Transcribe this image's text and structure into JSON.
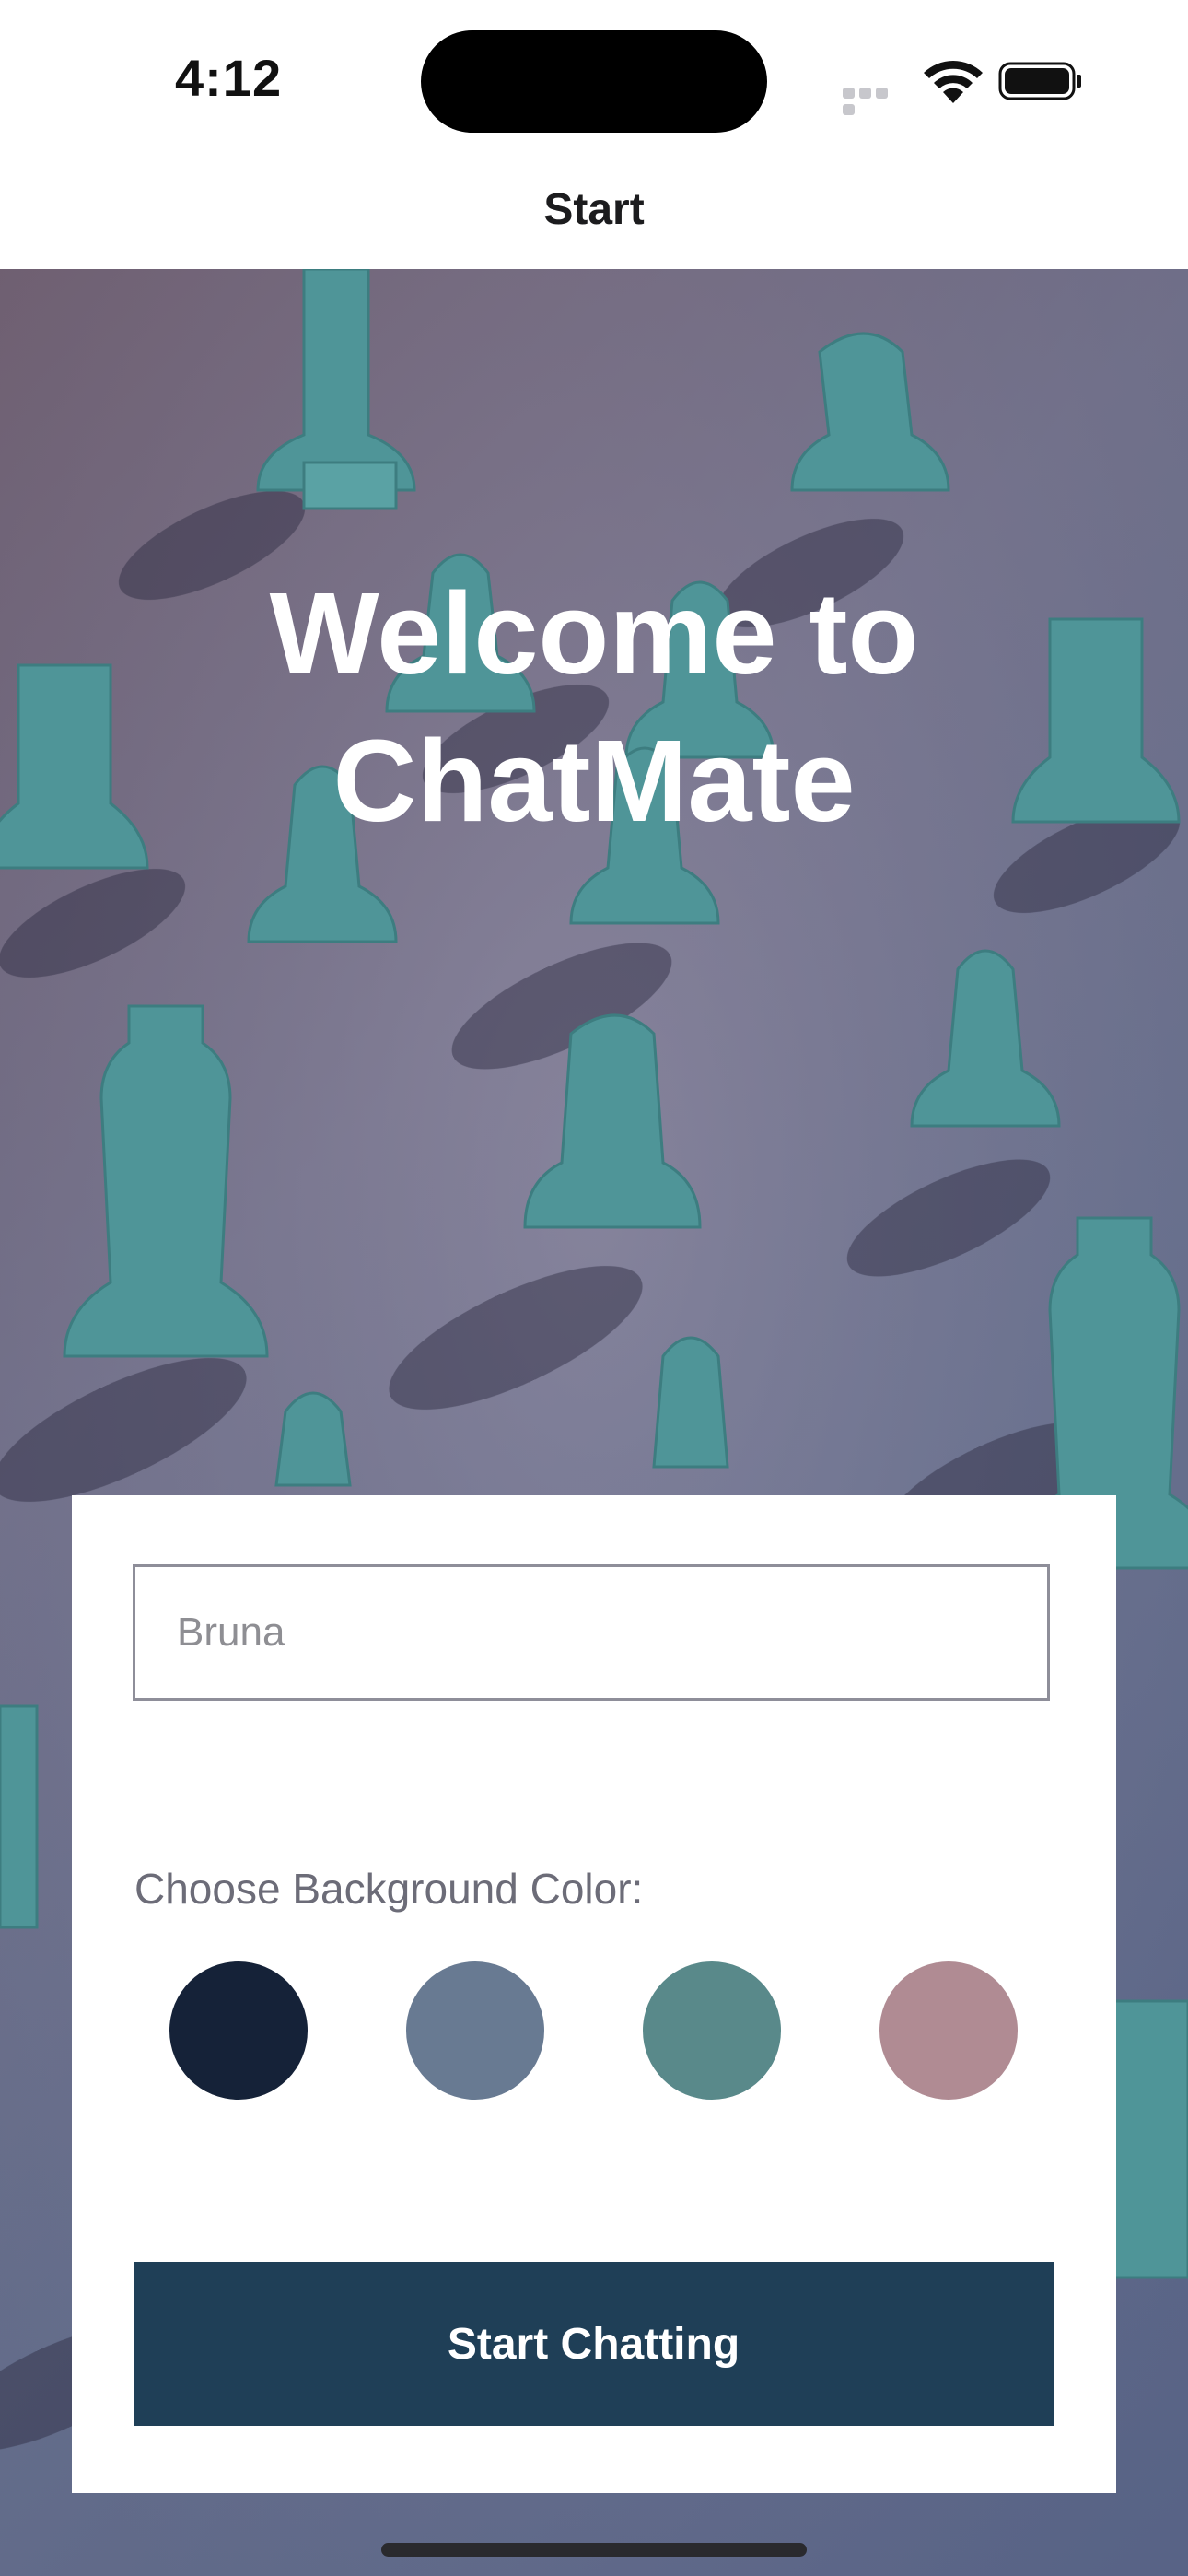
{
  "status_bar": {
    "time": "4:12"
  },
  "nav": {
    "title": "Start"
  },
  "hero": {
    "title_line1": "Welcome to",
    "title_line2": "ChatMate"
  },
  "form": {
    "name_value": "Bruna",
    "color_label": "Choose Background Color:",
    "colors": [
      "#152238",
      "#687a92",
      "#59898a",
      "#b08b93"
    ],
    "start_label": "Start Chatting",
    "button_color": "#1f3f57"
  },
  "icons": [
    "cellular-signal-icon",
    "wifi-icon",
    "battery-icon"
  ]
}
